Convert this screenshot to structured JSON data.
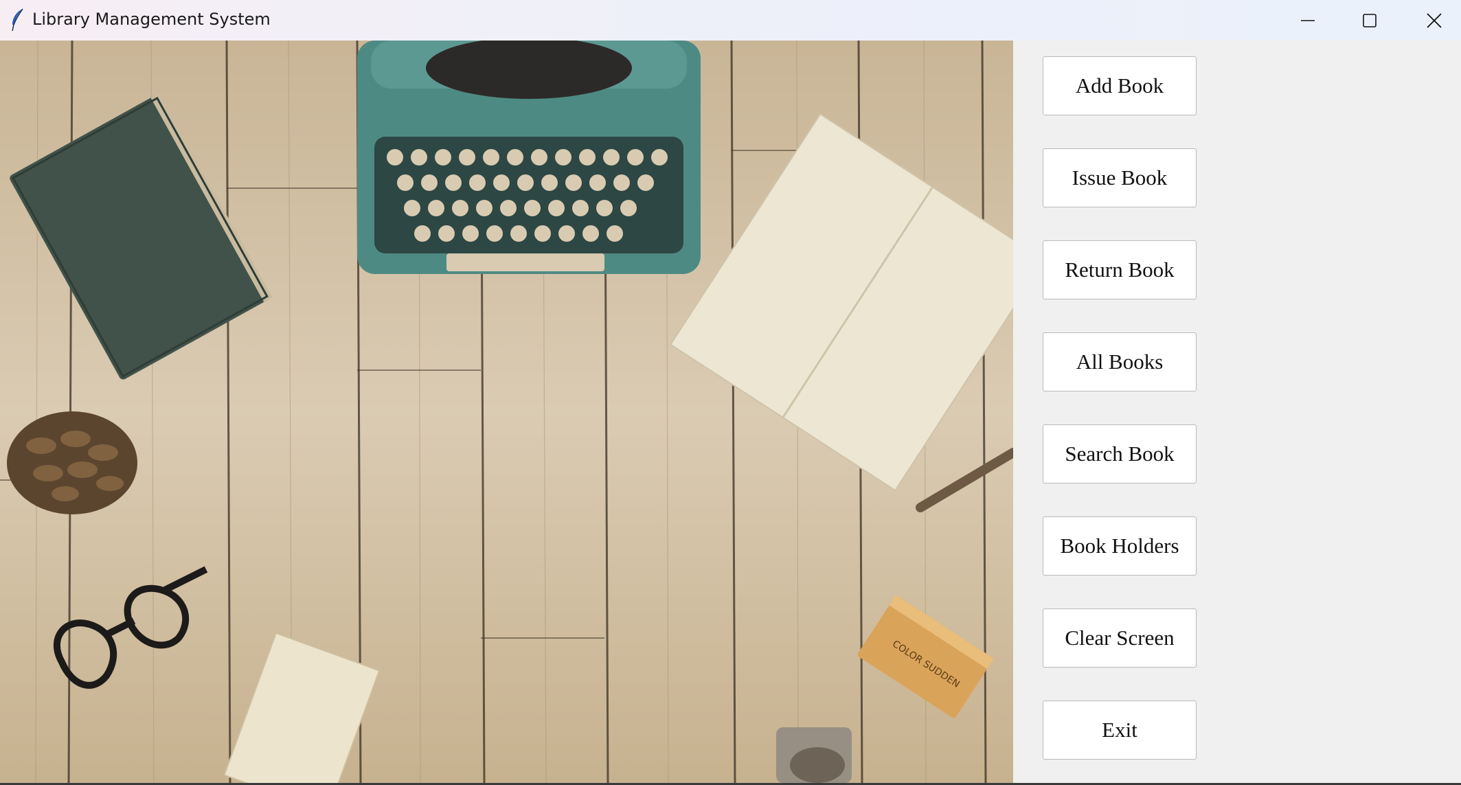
{
  "window": {
    "title": "Library Management System",
    "icon": "feather-quill-icon",
    "controls": [
      "minimize-icon",
      "maximize-icon",
      "close-icon"
    ]
  },
  "background_photo": {
    "description_icon": "desk-photo-typewriter-notebook-books",
    "stamp_text": "COLOR SUDDEN"
  },
  "menu": {
    "buttons": [
      {
        "label": "Add Book"
      },
      {
        "label": "Issue Book"
      },
      {
        "label": "Return Book"
      },
      {
        "label": "All Books"
      },
      {
        "label": "Search Book"
      },
      {
        "label": "Book Holders"
      },
      {
        "label": "Clear Screen"
      },
      {
        "label": "Exit"
      }
    ]
  },
  "colors": {
    "panel_bg": "#f0f0f0",
    "button_bg": "#ffffff",
    "wood": "#d6c5ab",
    "typewriter": "#4e8a84"
  }
}
